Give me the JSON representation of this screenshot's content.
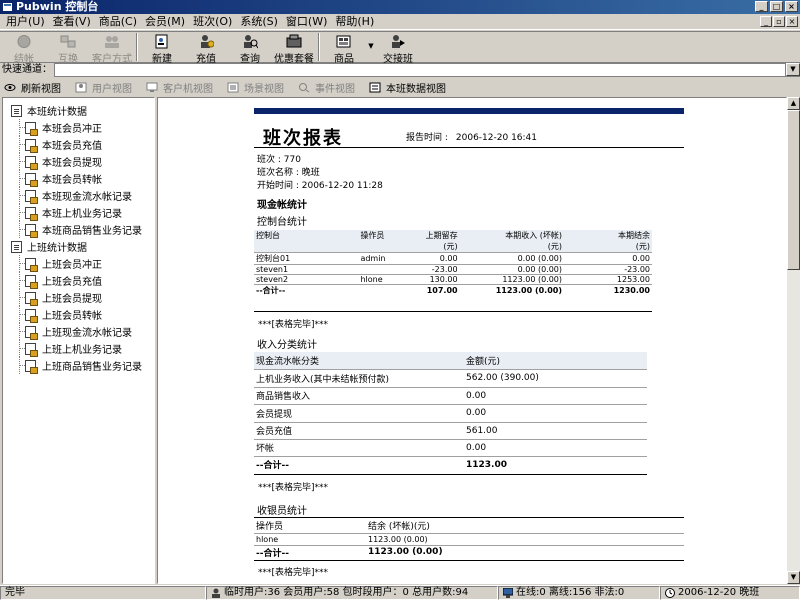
{
  "window": {
    "title": "Pubwin 控制台"
  },
  "menu": [
    "用户(U)",
    "查看(V)",
    "商品(C)",
    "会员(M)",
    "班次(O)",
    "系统(S)",
    "窗口(W)",
    "帮助(H)"
  ],
  "toolbar": {
    "buttons": [
      {
        "label": "结帐",
        "icon": "stop-icon"
      },
      {
        "label": "互换",
        "icon": "exchange-icon"
      },
      {
        "label": "客户方式",
        "icon": "users-icon"
      },
      {
        "label": "新建",
        "icon": "new-card-icon"
      },
      {
        "label": "充值",
        "icon": "recharge-icon"
      },
      {
        "label": "查询",
        "icon": "search-user-icon"
      },
      {
        "label": "优惠套餐",
        "icon": "package-icon"
      },
      {
        "label": "商品",
        "icon": "goods-icon"
      },
      {
        "label": "交接班",
        "icon": "handover-icon"
      }
    ]
  },
  "quickbar": {
    "label": "快速通道："
  },
  "tabs": [
    {
      "label": "刷新视图"
    },
    {
      "label": "用户视图"
    },
    {
      "label": "客户机视图"
    },
    {
      "label": "场景视图"
    },
    {
      "label": "事件视图"
    },
    {
      "label": "本班数据视图"
    }
  ],
  "tree": [
    {
      "group": "本班统计数据",
      "items": [
        "本班会员冲正",
        "本班会员充值",
        "本班会员提现",
        "本班会员转帐",
        "本班现金流水帐记录",
        "本班上机业务记录",
        "本班商品销售业务记录"
      ]
    },
    {
      "group": "上班统计数据",
      "items": [
        "上班会员冲正",
        "上班会员充值",
        "上班会员提现",
        "上班会员转帐",
        "上班现金流水帐记录",
        "上班上机业务记录",
        "上班商品销售业务记录"
      ]
    }
  ],
  "report": {
    "title": "班次报表",
    "time_label": "报告时间 :",
    "time_value": "2006-12-20 16:41",
    "meta": [
      "班次 : 770",
      "班次名称 : 晚班",
      "开始时间 : 2006-12-20 11:28"
    ],
    "section_cash": "现金帐统计",
    "console": {
      "title": "控制台统计",
      "headers": [
        "控制台",
        "操作员",
        "上期留存",
        "本期收入 (坏帐)",
        "本期结余"
      ],
      "units": [
        "",
        "",
        "(元)",
        "(元)",
        "(元)"
      ],
      "rows": [
        [
          "控制台01",
          "admin",
          "0.00",
          "0.00 (0.00)",
          "0.00"
        ],
        [
          "steven1",
          "",
          "-23.00",
          "0.00 (0.00)",
          "-23.00"
        ],
        [
          "steven2",
          "hlone",
          "130.00",
          "1123.00 (0.00)",
          "1253.00"
        ]
      ],
      "total": [
        "--合计--",
        "",
        "107.00",
        "1123.00 (0.00)",
        "1230.00"
      ],
      "done": "***[表格完毕]***"
    },
    "income": {
      "title": "收入分类统计",
      "headers": [
        "现金流水帐分类",
        "金额(元)"
      ],
      "rows": [
        [
          "上机业务收入(其中未结帐预付款)",
          "562.00 (390.00)"
        ],
        [
          "商品销售收入",
          "0.00"
        ],
        [
          "会员提现",
          "0.00"
        ],
        [
          "会员充值",
          "561.00"
        ],
        [
          "坏帐",
          "0.00"
        ]
      ],
      "total": [
        "--合计--",
        "1123.00"
      ],
      "done": "***[表格完毕]***"
    },
    "cashier": {
      "title": "收银员统计",
      "headers": [
        "操作员",
        "结余 (坏帐)(元)"
      ],
      "rows": [
        [
          "hlone",
          "1123.00 (0.00)"
        ]
      ],
      "total": [
        "--合计--",
        "1123.00 (0.00)"
      ],
      "done": "***[表格完毕]***"
    }
  },
  "status": {
    "left": "完毕",
    "counts": "临时用户:36  会员用户:58  包时段用户：0  总用户数:94",
    "online": "在线:0  离线:156  非法:0",
    "shift": "2006-12-20 晚班"
  },
  "colors": {
    "title_bar": "#0a246a",
    "report_bar": "#0a246a",
    "window_bg": "#d4d0c8"
  }
}
